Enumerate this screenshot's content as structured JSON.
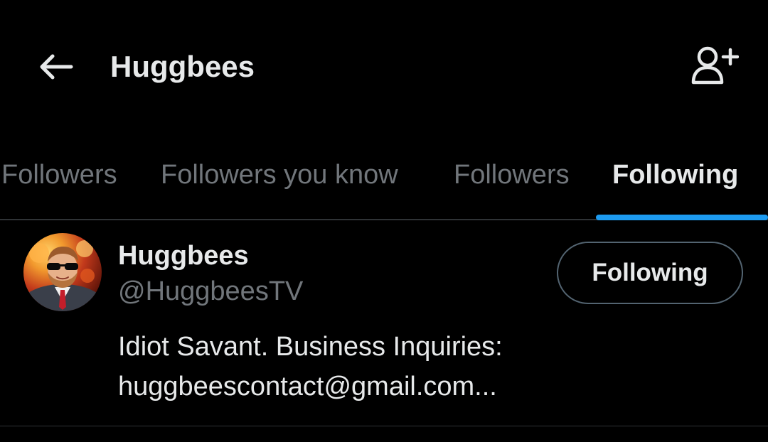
{
  "header": {
    "title": "Huggbees",
    "back_icon": "arrow-left-icon",
    "add_user_icon": "person-add-icon"
  },
  "tabs": [
    {
      "label": "Followers",
      "active": false
    },
    {
      "label": "Followers you know",
      "active": false
    },
    {
      "label": "Followers",
      "active": false
    },
    {
      "label": "Following",
      "active": true
    }
  ],
  "users": [
    {
      "display_name": "Huggbees",
      "handle": "@HuggbeesTV",
      "button_label": "Following",
      "bio_lines": [
        "Idiot Savant. Business Inquiries:",
        "huggbeescontact@gmail.com..."
      ]
    }
  ],
  "colors": {
    "background": "#000000",
    "text_primary": "#e7e9ea",
    "text_secondary": "#71767b",
    "accent": "#1d9bf0",
    "divider": "#2f3336"
  }
}
